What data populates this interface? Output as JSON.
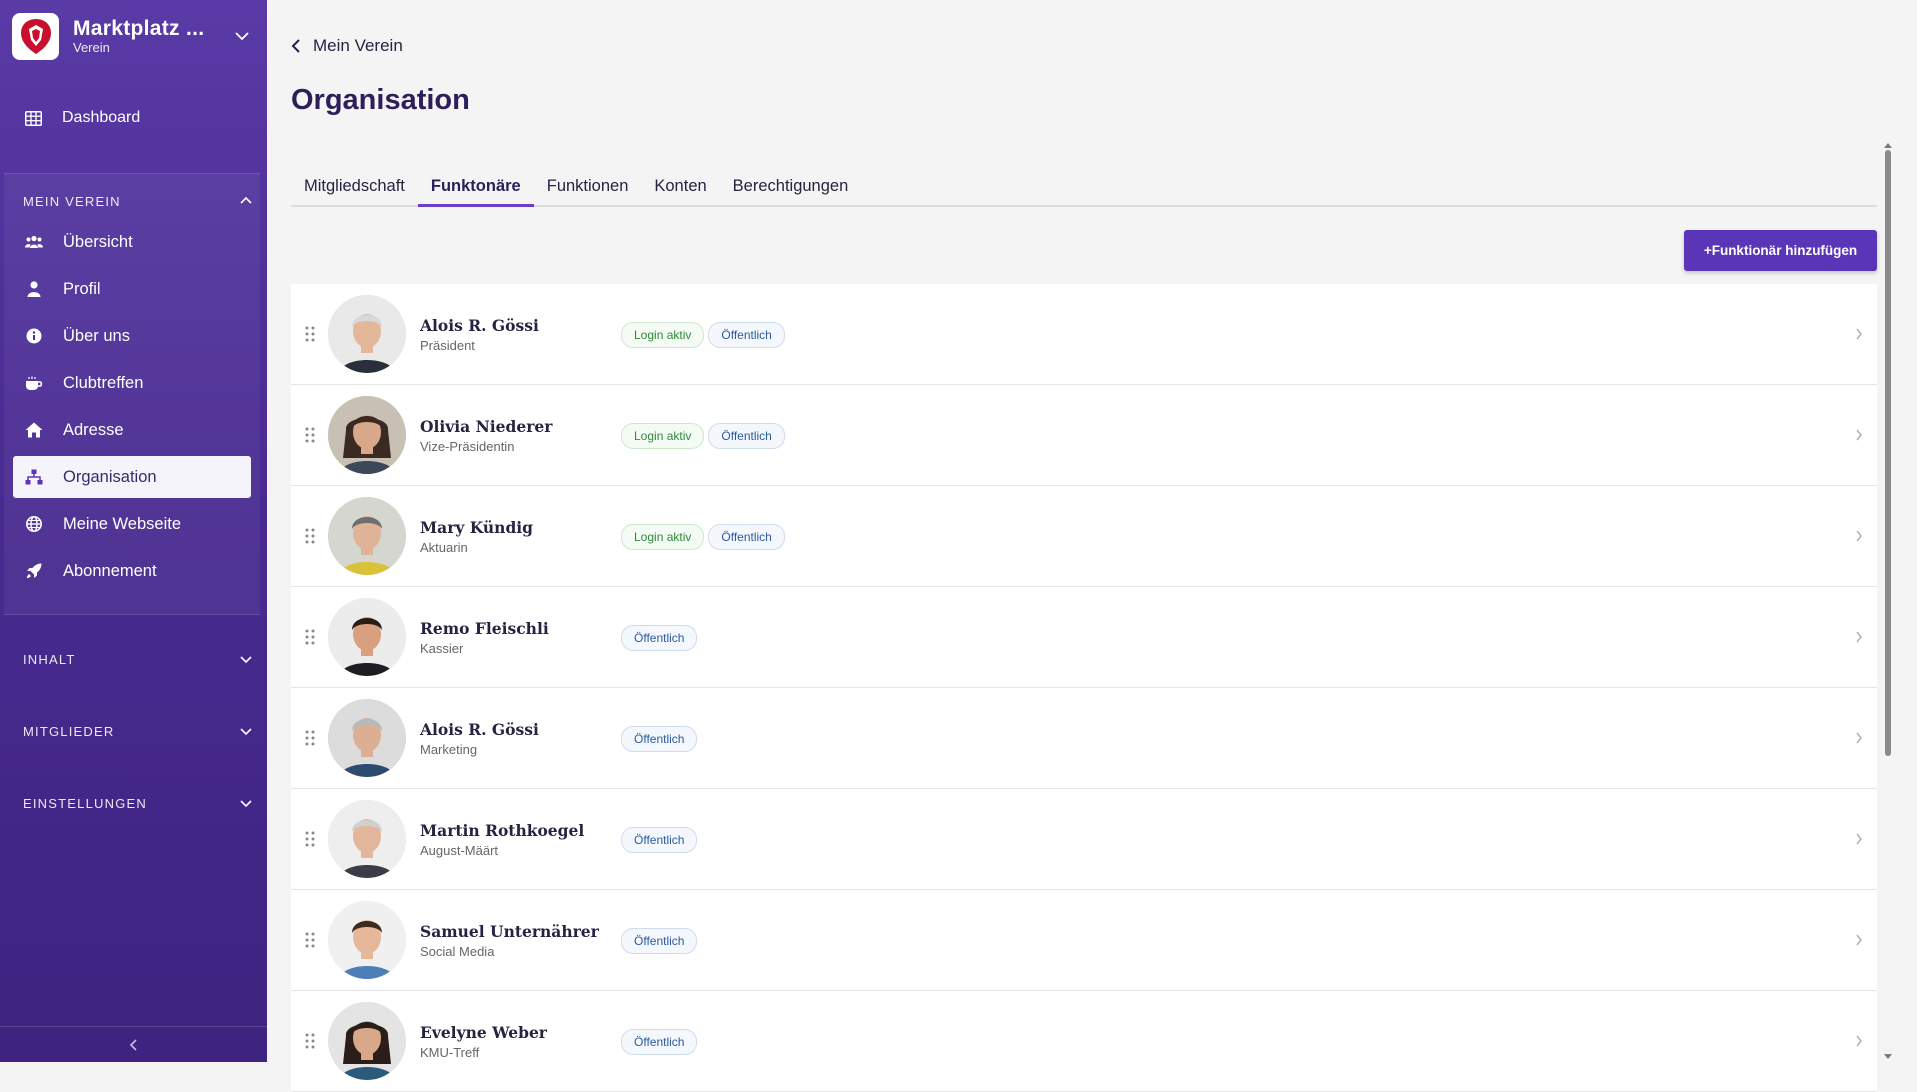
{
  "brand": {
    "title": "Marktplatz ...",
    "subtitle": "Verein"
  },
  "nav": {
    "dashboard": "Dashboard"
  },
  "groups": {
    "mein_verein": "MEIN VEREIN",
    "inhalt": "INHALT",
    "mitglieder": "MITGLIEDER",
    "einstellungen": "EINSTELLUNGEN"
  },
  "sidebar_items": [
    {
      "label": "Übersicht",
      "icon": "users-icon"
    },
    {
      "label": "Profil",
      "icon": "user-icon"
    },
    {
      "label": "Über uns",
      "icon": "info-icon"
    },
    {
      "label": "Clubtreffen",
      "icon": "coffee-icon"
    },
    {
      "label": "Adresse",
      "icon": "home-icon"
    },
    {
      "label": "Organisation",
      "icon": "sitemap-icon",
      "active": true
    },
    {
      "label": "Meine Webseite",
      "icon": "globe-icon"
    },
    {
      "label": "Abonnement",
      "icon": "rocket-icon"
    }
  ],
  "header": {
    "back_label": "Mein Verein",
    "title": "Organisation"
  },
  "tabs": [
    {
      "label": "Mitgliedschaft"
    },
    {
      "label": "Funktonäre",
      "active": true
    },
    {
      "label": "Funktionen"
    },
    {
      "label": "Konten"
    },
    {
      "label": "Berechtigungen"
    }
  ],
  "add_button_label": "+Funktionär hinzufügen",
  "officials": [
    {
      "name": "Alois R. Gössi",
      "role": "Präsident",
      "badges": [
        "Login aktiv",
        "Öffentlich"
      ]
    },
    {
      "name": "Olivia Niederer",
      "role": "Vize-Präsidentin",
      "badges": [
        "Login aktiv",
        "Öffentlich"
      ]
    },
    {
      "name": "Mary Kündig",
      "role": "Aktuarin",
      "badges": [
        "Login aktiv",
        "Öffentlich"
      ]
    },
    {
      "name": "Remo Fleischli",
      "role": "Kassier",
      "badges": [
        "Öffentlich"
      ]
    },
    {
      "name": "Alois R. Gössi",
      "role": "Marketing",
      "badges": [
        "Öffentlich"
      ]
    },
    {
      "name": "Martin Rothkoegel",
      "role": "August-Määrt",
      "badges": [
        "Öffentlich"
      ]
    },
    {
      "name": "Samuel Unternährer",
      "role": "Social Media",
      "badges": [
        "Öffentlich"
      ]
    },
    {
      "name": "Evelyne Weber",
      "role": "KMU-Treff",
      "badges": [
        "Öffentlich"
      ]
    }
  ],
  "colors": {
    "sidebar": "#4a2c93",
    "accent": "#5b35b8",
    "badge_green": "#2f8a3a",
    "badge_blue": "#2c5aa0"
  }
}
